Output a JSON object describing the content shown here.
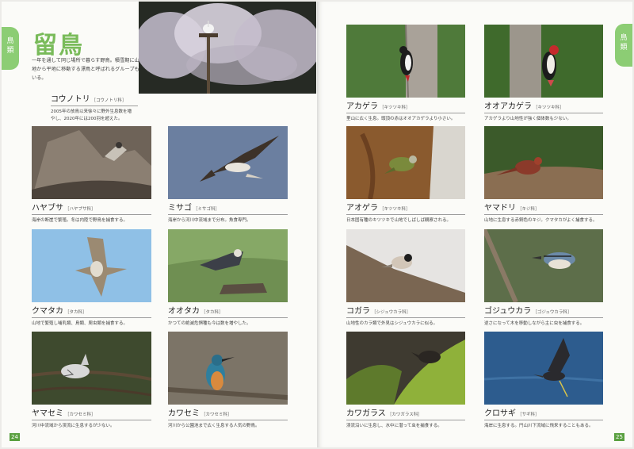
{
  "section": {
    "title": "留鳥",
    "tab_chars": [
      "鳥",
      "類"
    ],
    "intro": "一年を通して同じ場所で暮らす野鳥。積雪期に山地から平地に移動する漂鳥と呼ばれるグループもいる。"
  },
  "featured": {
    "name": "コウノトリ",
    "family": "［コウノトリ科］",
    "desc": "2005年の放鳥以来徐々に野外生息数を増やし、2020年には200羽を超えた。"
  },
  "left_birds": [
    {
      "name": "ハヤブサ",
      "family": "［ハヤブサ科］",
      "desc": "海岸の断崖で繁殖。冬は内陸で野鳥を捕食する。"
    },
    {
      "name": "ミサゴ",
      "family": "［ミサゴ科］",
      "desc": "海岸から河川中流域まで分布。魚食専門。"
    },
    {
      "name": "クマタカ",
      "family": "［タカ科］",
      "desc": "山地で繁殖し哺乳類、鳥類、爬虫類を捕食する。"
    },
    {
      "name": "オオタカ",
      "family": "［タカ科］",
      "desc": "かつての絶滅危惧種も今は数を増やした。"
    },
    {
      "name": "ヤマセミ",
      "family": "［カワセミ科］",
      "desc": "河川中流域から渓流に生息するが少ない。"
    },
    {
      "name": "カワセミ",
      "family": "［カワセミ科］",
      "desc": "河川から公園池まで広く生息する人気の野鳥。"
    }
  ],
  "right_birds": [
    {
      "name": "アカゲラ",
      "family": "［キツツキ科］",
      "desc": "里山に広く生息。頭頂の赤はオオアカゲラより小さい。"
    },
    {
      "name": "オオアカゲラ",
      "family": "［キツツキ科］",
      "desc": "アカゲラより山地性が強く個体数も少ない。"
    },
    {
      "name": "アオゲラ",
      "family": "［キツツキ科］",
      "desc": "日本固有種のキツツキで山地でしばしば観察される。"
    },
    {
      "name": "ヤマドリ",
      "family": "［キジ科］",
      "desc": "山地に生息する赤銅色のキジ。クマタカがよく捕食する。"
    },
    {
      "name": "コガラ",
      "family": "［シジュウカラ科］",
      "desc": "山地性のカラ類で外見はシジュウカラに似る。"
    },
    {
      "name": "ゴジュウカラ",
      "family": "［ゴジュウカラ科］",
      "desc": "逆さになって木を移動しながら主に虫を捕食する。"
    },
    {
      "name": "カワガラス",
      "family": "［カワガラス科］",
      "desc": "渓流沿いに生息し、水中に潜って虫を捕食する。"
    },
    {
      "name": "クロサギ",
      "family": "［サギ科］",
      "desc": "海岸に生息する。円山川下流域に飛来することもある。"
    }
  ],
  "page_numbers": {
    "left": "24",
    "right": "25"
  }
}
